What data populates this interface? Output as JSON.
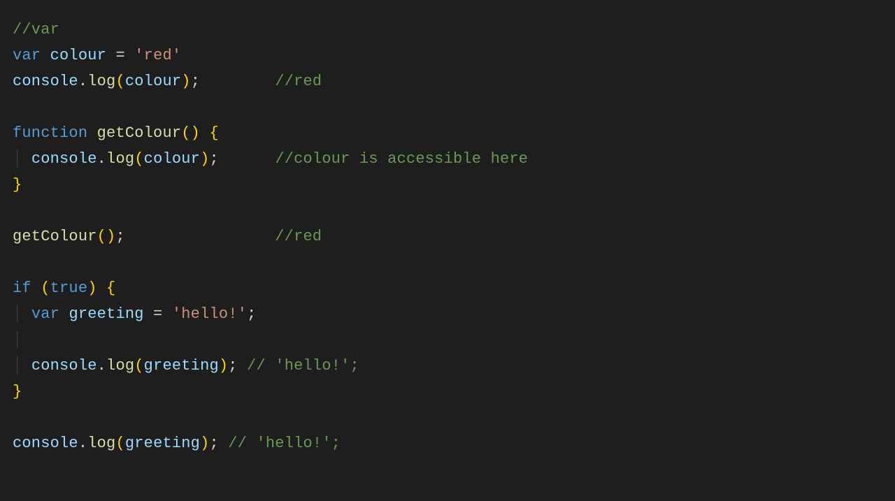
{
  "code": {
    "lines": [
      [
        {
          "cls": "tok-comment",
          "t": "//var"
        }
      ],
      [
        {
          "cls": "tok-keyword",
          "t": "var"
        },
        {
          "cls": "tok-punct",
          "t": " "
        },
        {
          "cls": "tok-var",
          "t": "colour"
        },
        {
          "cls": "tok-punct",
          "t": " = "
        },
        {
          "cls": "tok-string",
          "t": "'red'"
        }
      ],
      [
        {
          "cls": "tok-var",
          "t": "console"
        },
        {
          "cls": "tok-punct",
          "t": "."
        },
        {
          "cls": "tok-fn",
          "t": "log"
        },
        {
          "cls": "tok-paren",
          "t": "("
        },
        {
          "cls": "tok-var",
          "t": "colour"
        },
        {
          "cls": "tok-paren",
          "t": ")"
        },
        {
          "cls": "tok-punct",
          "t": ";        "
        },
        {
          "cls": "tok-comment",
          "t": "//red"
        }
      ],
      [],
      [
        {
          "cls": "tok-keyword",
          "t": "function"
        },
        {
          "cls": "tok-punct",
          "t": " "
        },
        {
          "cls": "tok-fn",
          "t": "getColour"
        },
        {
          "cls": "tok-paren",
          "t": "()"
        },
        {
          "cls": "tok-punct",
          "t": " "
        },
        {
          "cls": "tok-brace",
          "t": "{"
        }
      ],
      [
        {
          "cls": "guide",
          "t": "│ "
        },
        {
          "cls": "tok-var",
          "t": "console"
        },
        {
          "cls": "tok-punct",
          "t": "."
        },
        {
          "cls": "tok-fn",
          "t": "log"
        },
        {
          "cls": "tok-paren",
          "t": "("
        },
        {
          "cls": "tok-var",
          "t": "colour"
        },
        {
          "cls": "tok-paren",
          "t": ")"
        },
        {
          "cls": "tok-punct",
          "t": ";      "
        },
        {
          "cls": "tok-comment",
          "t": "//colour is accessible here"
        }
      ],
      [
        {
          "cls": "tok-brace",
          "t": "}"
        }
      ],
      [],
      [
        {
          "cls": "tok-fn",
          "t": "getColour"
        },
        {
          "cls": "tok-paren",
          "t": "()"
        },
        {
          "cls": "tok-punct",
          "t": ";                "
        },
        {
          "cls": "tok-comment",
          "t": "//red"
        }
      ],
      [],
      [
        {
          "cls": "tok-keyword",
          "t": "if"
        },
        {
          "cls": "tok-punct",
          "t": " "
        },
        {
          "cls": "tok-paren",
          "t": "("
        },
        {
          "cls": "tok-const",
          "t": "true"
        },
        {
          "cls": "tok-paren",
          "t": ")"
        },
        {
          "cls": "tok-punct",
          "t": " "
        },
        {
          "cls": "tok-brace",
          "t": "{"
        }
      ],
      [
        {
          "cls": "guide",
          "t": "│ "
        },
        {
          "cls": "tok-keyword",
          "t": "var"
        },
        {
          "cls": "tok-punct",
          "t": " "
        },
        {
          "cls": "tok-var",
          "t": "greeting"
        },
        {
          "cls": "tok-punct",
          "t": " = "
        },
        {
          "cls": "tok-string",
          "t": "'hello!'"
        },
        {
          "cls": "tok-punct",
          "t": ";"
        }
      ],
      [
        {
          "cls": "guide",
          "t": "│"
        }
      ],
      [
        {
          "cls": "guide",
          "t": "│ "
        },
        {
          "cls": "tok-var",
          "t": "console"
        },
        {
          "cls": "tok-punct",
          "t": "."
        },
        {
          "cls": "tok-fn",
          "t": "log"
        },
        {
          "cls": "tok-paren",
          "t": "("
        },
        {
          "cls": "tok-var",
          "t": "greeting"
        },
        {
          "cls": "tok-paren",
          "t": ")"
        },
        {
          "cls": "tok-punct",
          "t": "; "
        },
        {
          "cls": "tok-comment",
          "t": "// 'hello!';"
        }
      ],
      [
        {
          "cls": "tok-brace",
          "t": "}"
        }
      ],
      [],
      [
        {
          "cls": "tok-var",
          "t": "console"
        },
        {
          "cls": "tok-punct",
          "t": "."
        },
        {
          "cls": "tok-fn",
          "t": "log"
        },
        {
          "cls": "tok-paren",
          "t": "("
        },
        {
          "cls": "tok-var",
          "t": "greeting"
        },
        {
          "cls": "tok-paren",
          "t": ")"
        },
        {
          "cls": "tok-punct",
          "t": "; "
        },
        {
          "cls": "tok-comment",
          "t": "// 'hello!';"
        }
      ]
    ]
  }
}
